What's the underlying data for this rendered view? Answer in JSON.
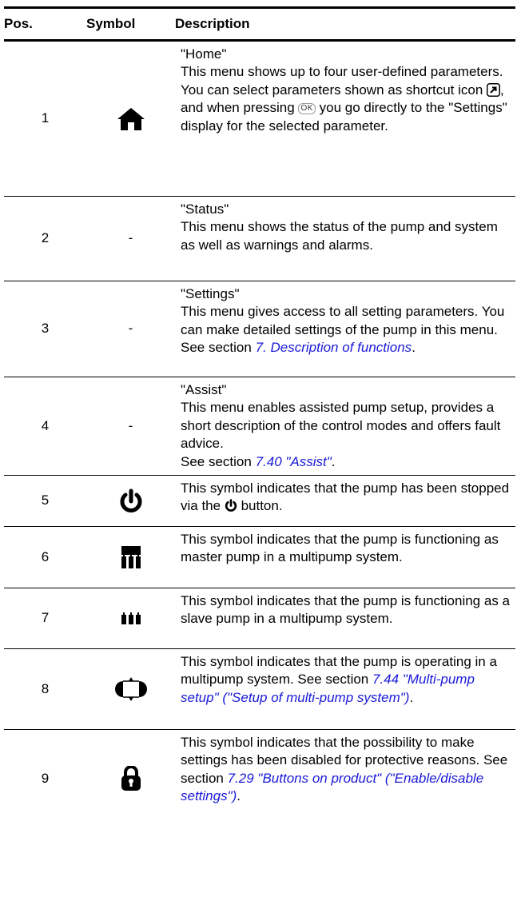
{
  "header": {
    "pos": "Pos.",
    "symbol": "Symbol",
    "description": "Description"
  },
  "rows": [
    {
      "pos": "1",
      "symbol_icon": "home-icon",
      "symbol_text": "",
      "title": "\"Home\"",
      "text_a": "This menu shows up to four user-defined parameters. You can select parameters shown as shortcut icon",
      "text_b": ", and when pressing",
      "ok_label": "OK",
      "text_c": "you go directly to the \"Settings\" display for the selected parameter."
    },
    {
      "pos": "2",
      "symbol_icon": "",
      "symbol_text": "-",
      "title": "\"Status\"",
      "text": "This menu shows the status of the pump and system as well as warnings and alarms."
    },
    {
      "pos": "3",
      "symbol_icon": "",
      "symbol_text": "-",
      "title": "\"Settings\"",
      "text": "This menu gives access to all setting parameters. You can make detailed settings of the pump in this menu.",
      "see": "See section",
      "link": "7. Description of functions",
      "end": "."
    },
    {
      "pos": "4",
      "symbol_icon": "",
      "symbol_text": "-",
      "title": "\"Assist\"",
      "text": "This menu enables assisted pump setup, provides a short description of the control modes and offers fault advice.",
      "see": "See section",
      "link": "7.40 \"Assist\"",
      "end": "."
    },
    {
      "pos": "5",
      "symbol_icon": "power-icon",
      "text_a": "This symbol indicates that the pump has been stopped via the",
      "text_b": "button."
    },
    {
      "pos": "6",
      "symbol_icon": "master-pump-icon",
      "text": "This symbol indicates that the pump is functioning as master pump in a multipump system."
    },
    {
      "pos": "7",
      "symbol_icon": "slave-pump-icon",
      "text": "This symbol indicates that the pump is functioning as a slave pump in a multipump system."
    },
    {
      "pos": "8",
      "symbol_icon": "multipump-icon",
      "text": "This symbol indicates that the pump is operating in a multipump system. See section",
      "link": "7.44 \"Multi-pump setup\" (\"Setup of multi-pump system\")",
      "end": "."
    },
    {
      "pos": "9",
      "symbol_icon": "lock-icon",
      "text": "This symbol indicates that the possibility to make settings has been disabled for protective reasons. See section",
      "link": "7.29 \"Buttons on product\" (\"Enable/disable settings\")",
      "end": "."
    }
  ],
  "colors": {
    "text": "#000000",
    "link": "#1a1ad8"
  }
}
